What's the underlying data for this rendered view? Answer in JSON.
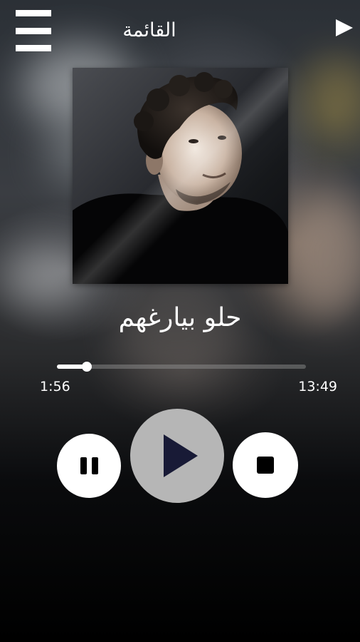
{
  "header": {
    "title": "القائمة",
    "menu_icon": "hamburger-menu-icon",
    "play_icon": "play-triangle-icon"
  },
  "now_playing": {
    "album_art": "singer-portrait",
    "song_title": "حلو بيارغهم",
    "elapsed_time": "1:56",
    "total_time": "13:49",
    "progress_fraction": 0.12
  },
  "controls": {
    "pause_icon": "pause-icon",
    "play_icon": "play-icon",
    "stop_icon": "stop-icon"
  },
  "colors": {
    "accent": "#ffffff",
    "play_button_bg": "#b6b6b6",
    "play_icon_color": "#181a36"
  }
}
